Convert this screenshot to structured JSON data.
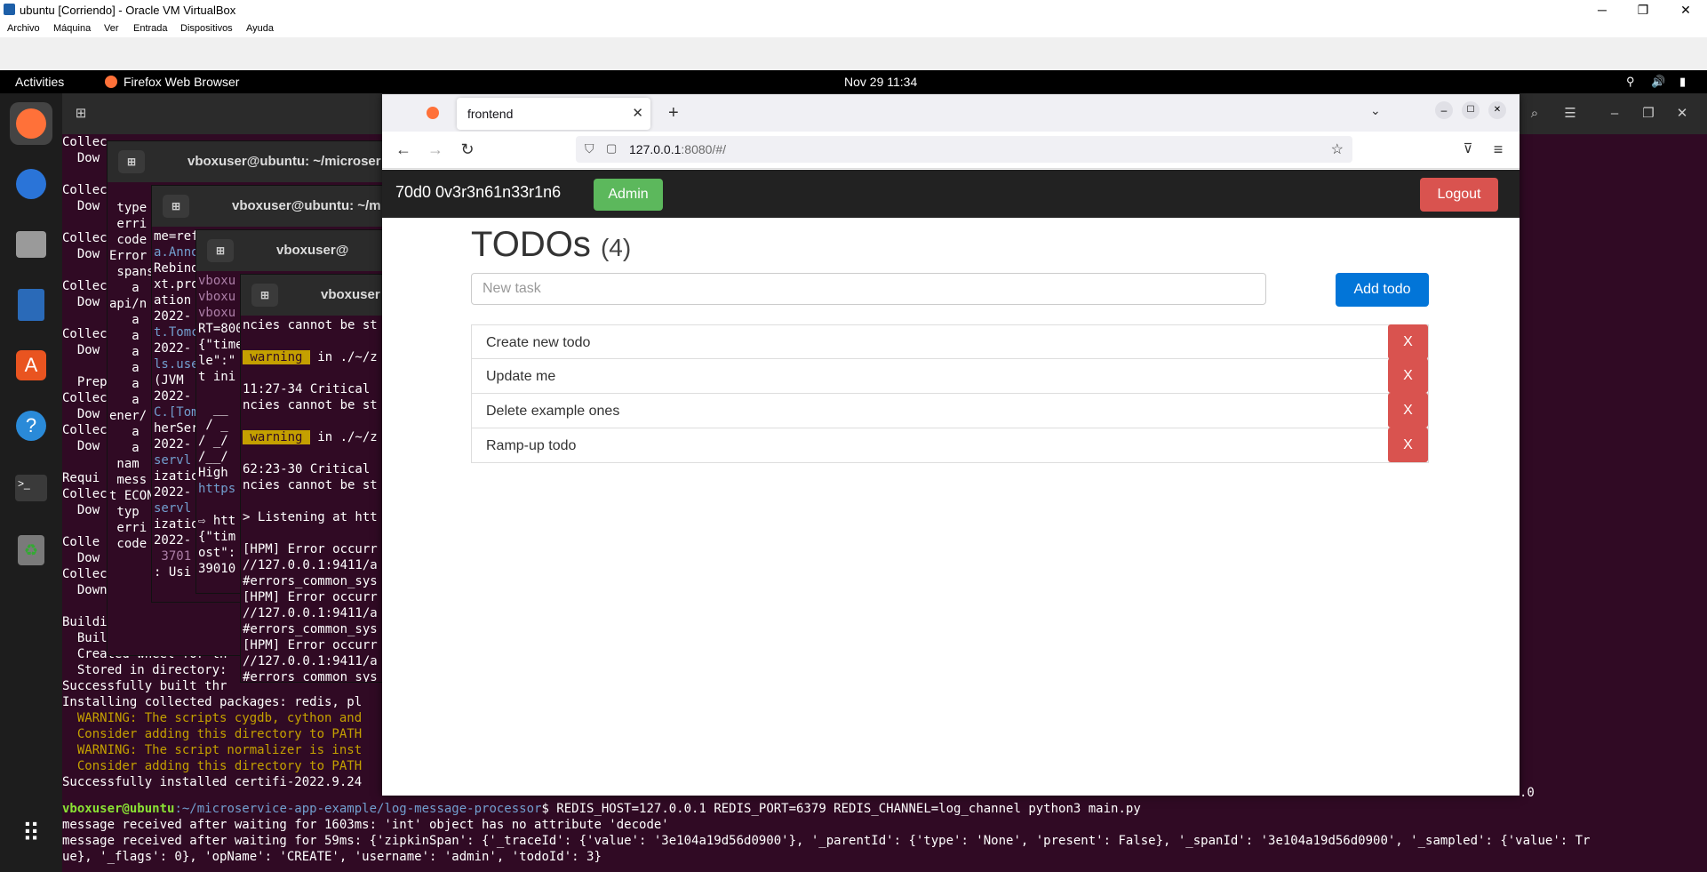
{
  "vbox": {
    "title": "ubuntu [Corriendo] - Oracle VM VirtualBox",
    "menu": [
      "Archivo",
      "Máquina",
      "Ver",
      "Entrada",
      "Dispositivos",
      "Ayuda"
    ]
  },
  "topbar": {
    "activities": "Activities",
    "app": "Firefox Web Browser",
    "datetime": "Nov 29  11:34"
  },
  "terminals": {
    "t1_title": "vboxuser@ubuntu: ~/microser",
    "t2_title": "vboxuser@ubuntu: ~/m",
    "t3_title": "vboxuser@",
    "t4_title": "vboxuser"
  },
  "main_term": {
    "lines": [
      "Collec",
      "  Dow",
      "",
      "Collec",
      "  Dow",
      "",
      "Collec",
      "  Dow",
      "",
      "Collec",
      "  Dow",
      "",
      "Collec",
      "  Dow",
      "",
      "  Prep",
      "Collec",
      "  Dow",
      "Collec",
      "  Dow",
      "",
      "Requi",
      "Collec",
      "  Dow",
      "",
      "Colle",
      "  Dow",
      "Collecting",
      "  Downloadi",
      "",
      "Building wheels f",
      "  Building wheel",
      "  Created wheel for th",
      "  Stored in directory:",
      "Successfully built thr",
      "Installing collected packages: redis, pl",
      "  WARNING: The scripts cygdb, cython and",
      "  Consider adding this directory to PATH",
      "  WARNING: The script normalizer is inst",
      "  Consider adding this directory to PATH",
      "Successfully installed certifi-2022.9.24"
    ],
    "prompt_user": "vboxuser@ubuntu",
    "prompt_path": ":~/microservice-app-example/log-message-processor",
    "command": "$ REDIS_HOST=127.0.0.1 REDIS_PORT=6379 REDIS_CHANNEL=log_channel python3 main.py",
    "out1": "message received after waiting for 1603ms: 'int' object has no attribute 'decode'",
    "out2": "message received after waiting for 59ms: {'zipkinSpan': {'_traceId': {'value': '3e104a19d56d0900'}, '_parentId': {'type': 'None', 'present': False}, '_spanId': '3e104a19d56d0900', '_sampled': {'value': Tr",
    "out3": "ue}, '_flags': 0}, 'opName': 'CREATE', 'username': 'admin', 'todoId': 3}",
    "right_tail": ".0"
  },
  "firefox": {
    "tab_title": "frontend",
    "url_host": "127.0.0.1",
    "url_rest": ":8080/#/"
  },
  "app": {
    "brand": "70d0 0v3r3n61n33r1n6",
    "admin": "Admin",
    "logout": "Logout",
    "title": "TODOs",
    "count": "(4)",
    "new_task_placeholder": "New task",
    "add_todo": "Add todo",
    "todos": [
      {
        "text": "Create new todo",
        "del": "X"
      },
      {
        "text": "Update me",
        "del": "X"
      },
      {
        "text": "Delete example ones",
        "del": "X"
      },
      {
        "text": "Ramp-up todo",
        "del": "X"
      }
    ]
  }
}
